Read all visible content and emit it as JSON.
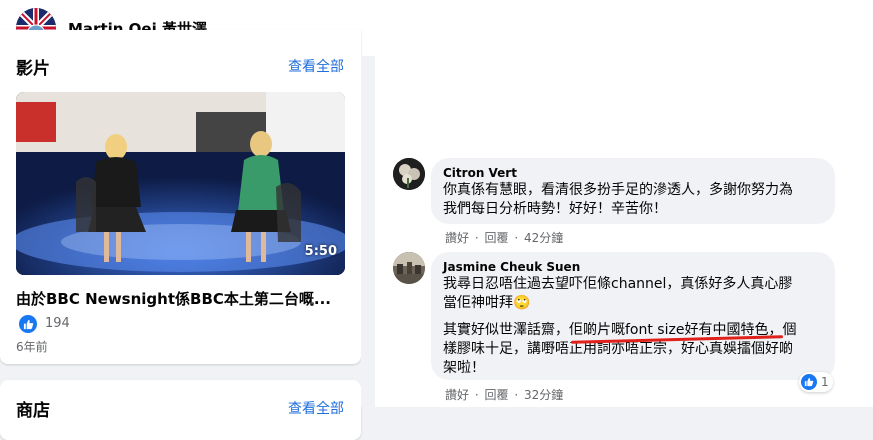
{
  "page": {
    "name": "Martin Oei 黃世澤"
  },
  "videos_card": {
    "title": "影片",
    "see_all": "查看全部",
    "video": {
      "duration": "5:50",
      "title": "由於BBC Newsnight係BBC本土第二台嘅...",
      "likes": "194",
      "time": "6年前"
    }
  },
  "shop_card": {
    "title": "商店",
    "see_all": "查看全部"
  },
  "comments": [
    {
      "author": "Citron Vert",
      "text": [
        "你真係有慧眼，看清很多扮手足的滲透人，多謝你努力為",
        "我們每日分析時勢！好好！辛苦你！"
      ],
      "like": "讚好",
      "reply": "回覆",
      "time": "42分鐘"
    },
    {
      "author": "Jasmine Cheuk Suen",
      "text": [
        "我尋日忍唔住過去望吓佢條channel，真係好多人真心膠",
        "當佢神咁拜🙄"
      ],
      "text2": [
        "其實好似世澤話齋，佢啲片嘅font size好有中國特色，個",
        "樣膠味十足，講嘢唔正用詞亦唔正宗，好心真娛擂個好啲",
        "架啦！"
      ],
      "like": "讚好",
      "reply": "回覆",
      "time": "32分鐘",
      "reactions": "1"
    }
  ]
}
